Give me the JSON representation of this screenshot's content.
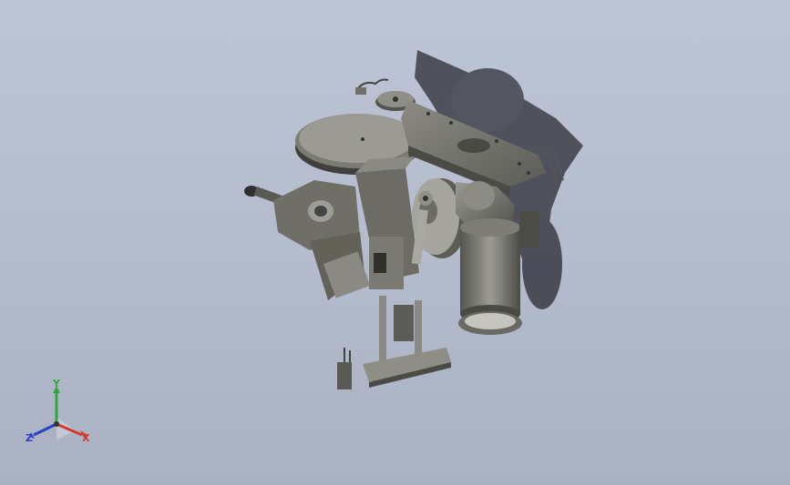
{
  "viewport": {
    "background_top": "#bcc4d6",
    "background_bottom": "#a9b1c3"
  },
  "model": {
    "description_icon": "cad-assembly-model",
    "body_color": "#6e6e68",
    "shadow_color": "#3a3c46"
  },
  "triad": {
    "x_label": "X",
    "y_label": "Y",
    "z_label": "Z",
    "x_color": "#d43a2a",
    "y_color": "#2ea83a",
    "z_color": "#2b3fc8"
  }
}
